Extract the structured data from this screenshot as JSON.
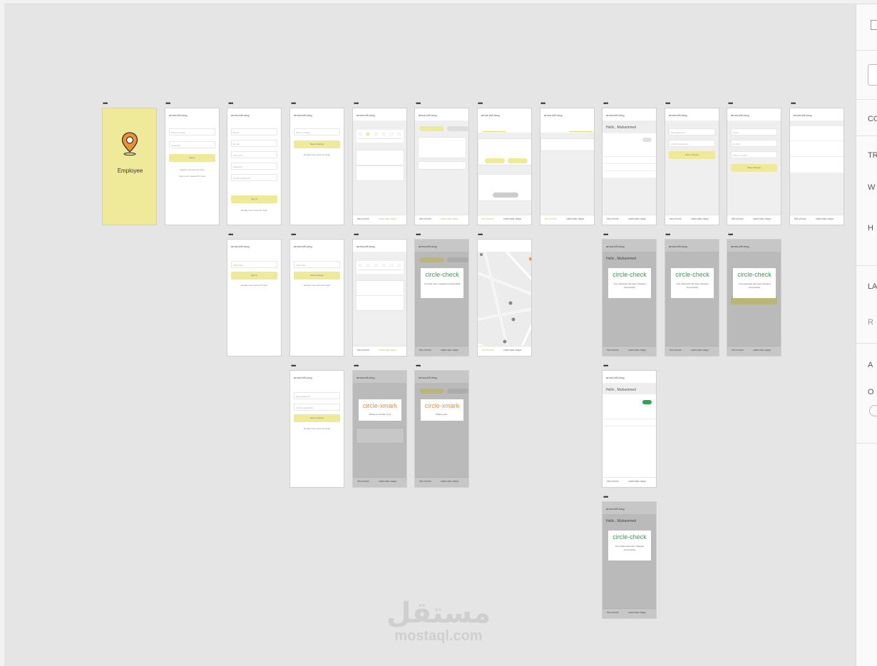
{
  "splash": {
    "label": "Employee"
  },
  "common": {
    "header": "arrow-left-long",
    "nav_list": "list-check",
    "nav_calendar": "calendar-days",
    "nav_user": "user",
    "nav_end": "user",
    "hello": "Hello , Muhammed",
    "menu_dots": "•••"
  },
  "popups": {
    "success": "circle-check",
    "fail": "circle-xmark",
    "msg_register": "You have been registered successfully",
    "msg_password": "Your password has been changed successfully",
    "msg_status": "Your status has been changed successfully",
    "msg_error": "Please try another time",
    "msg_wait": "Please wait..."
  },
  "forms": {
    "phone": "Phone number",
    "password": "password",
    "sign_in": "Sign in",
    "name": "Name",
    "email": "E-mail",
    "full_name": "Full name",
    "confirm": "Confirm password",
    "new_password": "New password",
    "save": "Save changes",
    "otp": "OTP code",
    "register_link": "register new account here",
    "forgot_link": "forgot your password? reset",
    "already": "already have account? login"
  },
  "right_panel": [
    "CO",
    "TR",
    "W",
    "H",
    "LA",
    "R",
    "A",
    "O"
  ],
  "watermark": {
    "arabic": "مستقل",
    "latin": "mostaql.com"
  }
}
